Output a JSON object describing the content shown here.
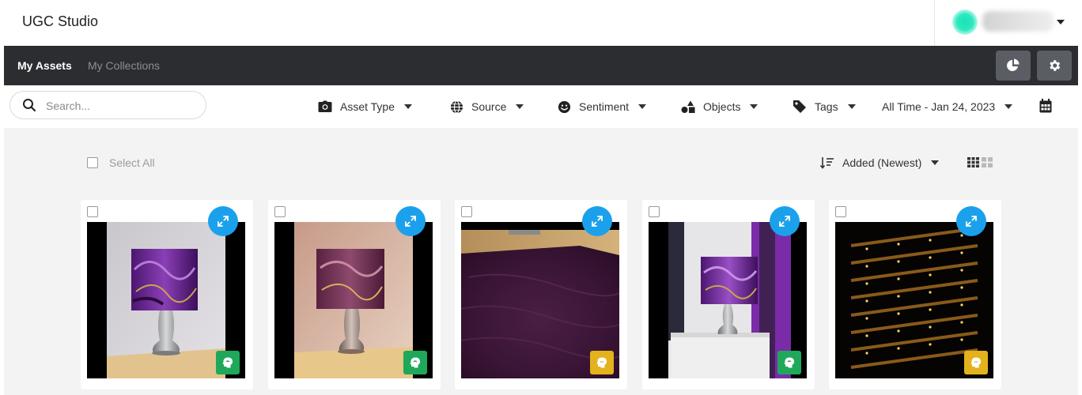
{
  "header": {
    "app_title": "UGC Studio",
    "user_menu_icon": "chevron-down-icon"
  },
  "nav": {
    "tabs": [
      {
        "label": "My Assets",
        "active": true
      },
      {
        "label": "My Collections",
        "active": false
      }
    ],
    "buttons": [
      {
        "icon": "pie-chart-icon"
      },
      {
        "icon": "gear-icon"
      }
    ]
  },
  "filters": {
    "search": {
      "placeholder": "Search...",
      "value": ""
    },
    "items": [
      {
        "label": "Asset Type",
        "icon": "camera-icon"
      },
      {
        "label": "Source",
        "icon": "globe-icon"
      },
      {
        "label": "Sentiment",
        "icon": "smiley-icon"
      },
      {
        "label": "Objects",
        "icon": "shapes-icon"
      },
      {
        "label": "Tags",
        "icon": "tag-icon"
      }
    ],
    "date_range": "All Time - Jan 24, 2023",
    "calendar_icon": "calendar-icon"
  },
  "toolbar": {
    "select_all_label": "Select All",
    "sort_label": "Added (Newest)",
    "sort_icon": "sort-descending-icon",
    "view_icons": [
      "grid-small-icon",
      "grid-large-icon"
    ]
  },
  "colors": {
    "nav_bg": "#2b2d31",
    "accent_blue": "#1ba1ec",
    "sentiment_positive": "#1fa85a",
    "sentiment_neutral": "#e3b21c"
  },
  "assets": [
    {
      "subject": "purple marble lamp",
      "sentiment": "positive",
      "sentiment_color": "#1fa85a"
    },
    {
      "subject": "purple marble lamp, warm light",
      "sentiment": "positive",
      "sentiment_color": "#1fa85a"
    },
    {
      "subject": "purple shag rug",
      "sentiment": "neutral",
      "sentiment_color": "#e3b21c"
    },
    {
      "subject": "lamp beside purple wall",
      "sentiment": "positive",
      "sentiment_color": "#1fa85a"
    },
    {
      "subject": "building at night",
      "sentiment": "neutral",
      "sentiment_color": "#e3b21c"
    }
  ]
}
